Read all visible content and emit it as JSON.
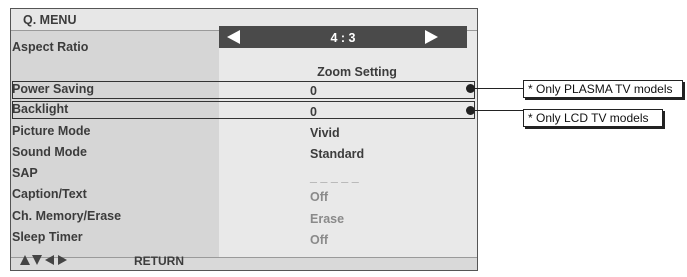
{
  "menu": {
    "title": "Q. MENU",
    "aspect_ratio": {
      "label": "Aspect Ratio",
      "value": "4 : 3"
    },
    "zoom_setting": "Zoom Setting",
    "rows": [
      {
        "label": "Power Saving",
        "value": "0"
      },
      {
        "label": "Backlight",
        "value": "0"
      },
      {
        "label": "Picture Mode",
        "value": "Vivid"
      },
      {
        "label": "Sound Mode",
        "value": "Standard"
      },
      {
        "label": "SAP",
        "value": "_ _ _ _ _"
      },
      {
        "label": "Caption/Text",
        "value": "Off"
      },
      {
        "label": "Ch. Memory/Erase",
        "value": "Erase"
      },
      {
        "label": "Sleep Timer",
        "value": "Off"
      }
    ],
    "footer": {
      "return_label": "RETURN",
      "nav_icon": "arrow-keys-icon"
    }
  },
  "callouts": {
    "plasma": "* Only PLASMA TV models",
    "lcd": "* Only LCD TV models"
  },
  "colors": {
    "panel": "#e3e3e3",
    "left_col": "#d6d6d6",
    "aspect_bar": "#4a4a4a",
    "dim_text": "#8a8a8a"
  }
}
